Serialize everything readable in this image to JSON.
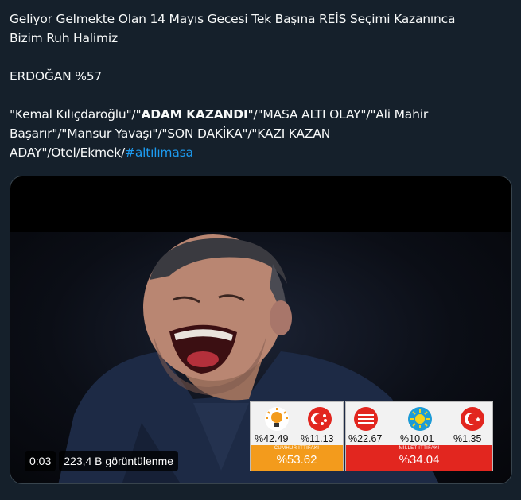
{
  "tweet": {
    "line1": "Geliyor Gelmekte Olan 14 Mayıs Gecesi Tek Başına REİS Seçimi Kazanınca",
    "line2": "Bizim Ruh Halimiz",
    "line3": "ERDOĞAN %57",
    "q_part1": "\"Kemal Kılıçdaroğlu\"/\"",
    "q_bold1": "ADAM KAZANDI",
    "q_part2": "\"/\"MASA ALTI OLAY\"/\"Ali Mahir",
    "q_part3": "Başarır\"/\"Mansur Yavaşı\"/\"SON DAK",
    "q_bold2": "İ",
    "q_part4": "KA\"/\"KAZI KAZAN",
    "q_part5": "ADAY\"/Otel/Ekmek/",
    "hashtag": "#altılımasa"
  },
  "video": {
    "timestamp": "0:03",
    "views": "223,4 B görüntülenme",
    "results": {
      "left": {
        "label": "CUMHUR İTTİFAKI",
        "total": "%53.62",
        "parties": [
          {
            "name": "ak-parti",
            "pct": "%42.49",
            "color": "#f39b1c"
          },
          {
            "name": "mhp",
            "pct": "%11.13",
            "color": "#e2261f"
          }
        ]
      },
      "right": {
        "label": "MİLLET İTTİFAKI",
        "total": "%34.04",
        "parties": [
          {
            "name": "chp",
            "pct": "%22.67",
            "color": "#e2261f"
          },
          {
            "name": "iyi-parti",
            "pct": "%10.01",
            "color": "#1d9bd6"
          },
          {
            "name": "saadet",
            "pct": "%1.35",
            "color": "#e2261f"
          }
        ]
      }
    }
  }
}
